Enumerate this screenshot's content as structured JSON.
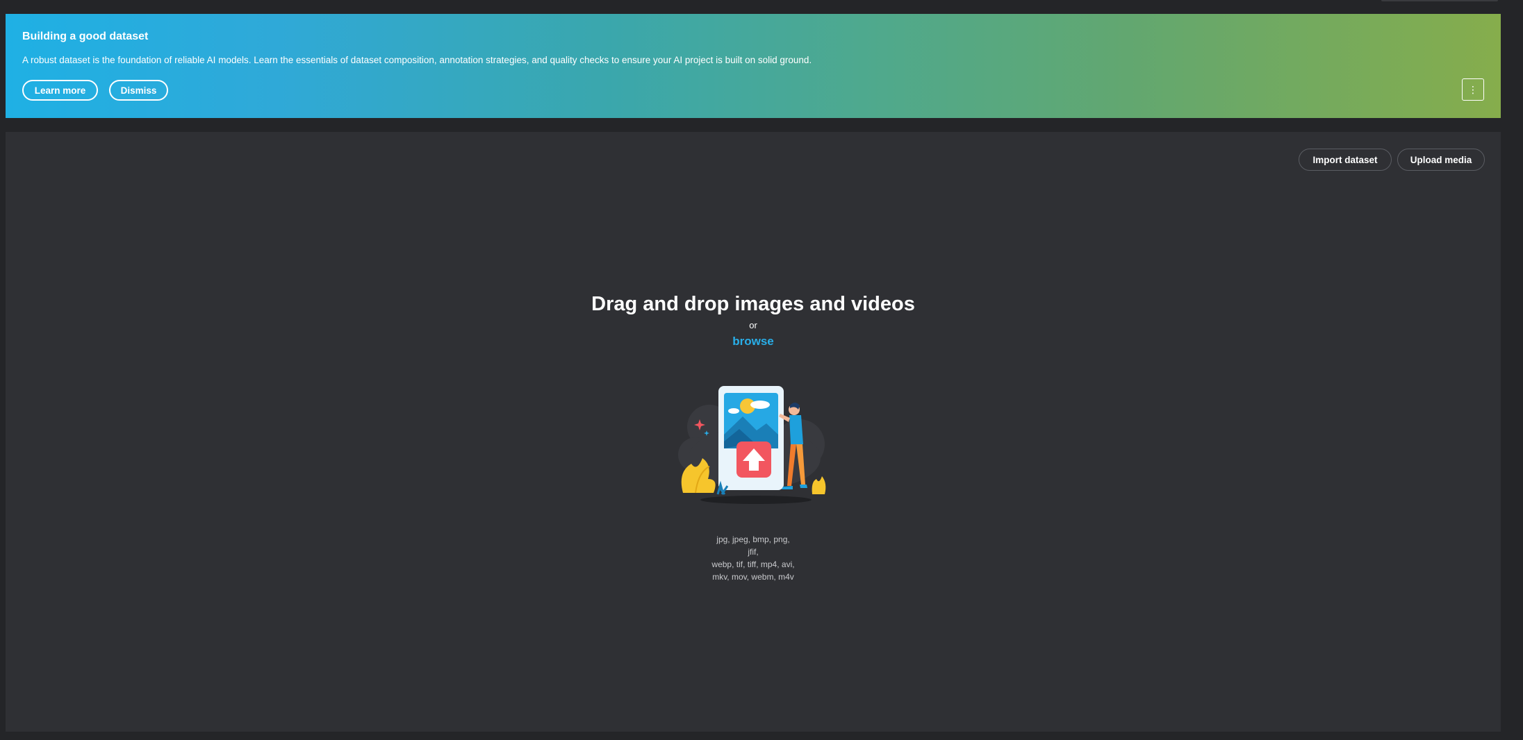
{
  "banner": {
    "title": "Building a good dataset",
    "description": "A robust dataset is the foundation of reliable AI models. Learn the essentials of dataset composition, annotation strategies, and quality checks to ensure your AI project is built on solid ground.",
    "learn_more_label": "Learn more",
    "dismiss_label": "Dismiss",
    "menu_icon": "more-vertical-icon",
    "colors": {
      "gradient_start": "#1fb0e4",
      "gradient_end": "#86ad4c"
    }
  },
  "toolbar": {
    "import_label": "Import dataset",
    "upload_label": "Upload media"
  },
  "dropzone": {
    "title": "Drag and drop images and videos",
    "or_text": "or",
    "browse_label": "browse",
    "formats_line1": "jpg, jpeg, bmp, png, jfif,",
    "formats_line2": "webp, tif, tiff, mp4, avi,",
    "formats_line3": "mkv, mov, webm, m4v",
    "illustration": "upload-media-illustration",
    "colors": {
      "link": "#29aee8",
      "upload_arrow_bg": "#f2565f"
    }
  },
  "theme": {
    "page_bg": "#242528",
    "panel_bg": "#2f3034"
  }
}
